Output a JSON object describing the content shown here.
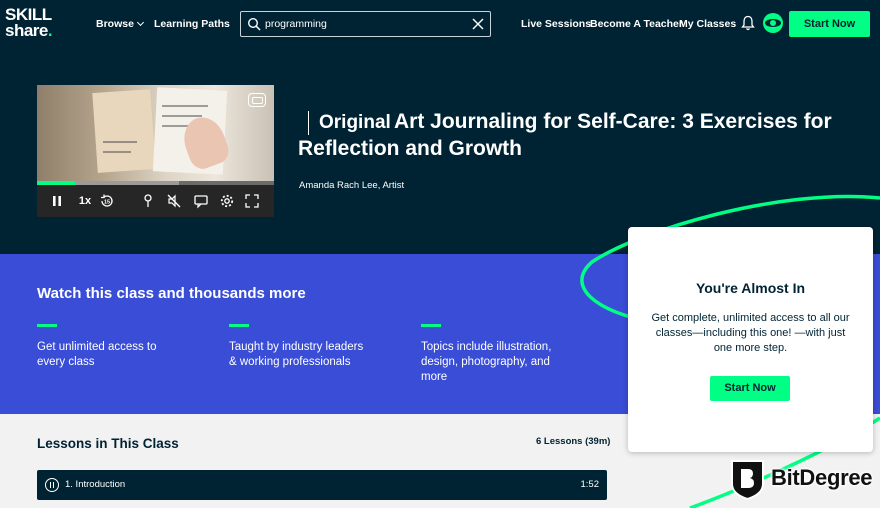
{
  "nav": {
    "logo_line1": "SKILL",
    "logo_line2": "share",
    "logo_dot": ".",
    "browse": "Browse",
    "learning_paths": "Learning Paths",
    "search_value": "programming",
    "live_sessions": "Live Sessions",
    "become_teacher": "Become A Teacher",
    "my_classes": "My Classes",
    "start_now": "Start Now"
  },
  "video": {
    "speed": "1x",
    "rewind": "15",
    "progress": 0.16,
    "buffered": 0.6
  },
  "hero": {
    "original_label": "Original",
    "title": "Art Journaling for Self-Care: 3 Exercises for Reflection and Growth",
    "teacher": "Amanda Rach Lee, Artist"
  },
  "band": {
    "title": "Watch this class and thousands more",
    "features": [
      "Get unlimited access to every class",
      "Taught by industry leaders & working professionals",
      "Topics include illustration, design, photography, and more"
    ]
  },
  "lessons": {
    "title": "Lessons in This Class",
    "count": "6 Lessons (39m)",
    "items": [
      {
        "name": "1. Introduction",
        "duration": "1:52"
      }
    ]
  },
  "card": {
    "title": "You're Almost In",
    "text": "Get complete, unlimited access to all our classes—including this one! —with just one more step.",
    "button": "Start Now"
  },
  "watermark": "BitDegree",
  "colors": {
    "navy": "#002333",
    "green": "#00ff84",
    "purple": "#394dd6"
  }
}
